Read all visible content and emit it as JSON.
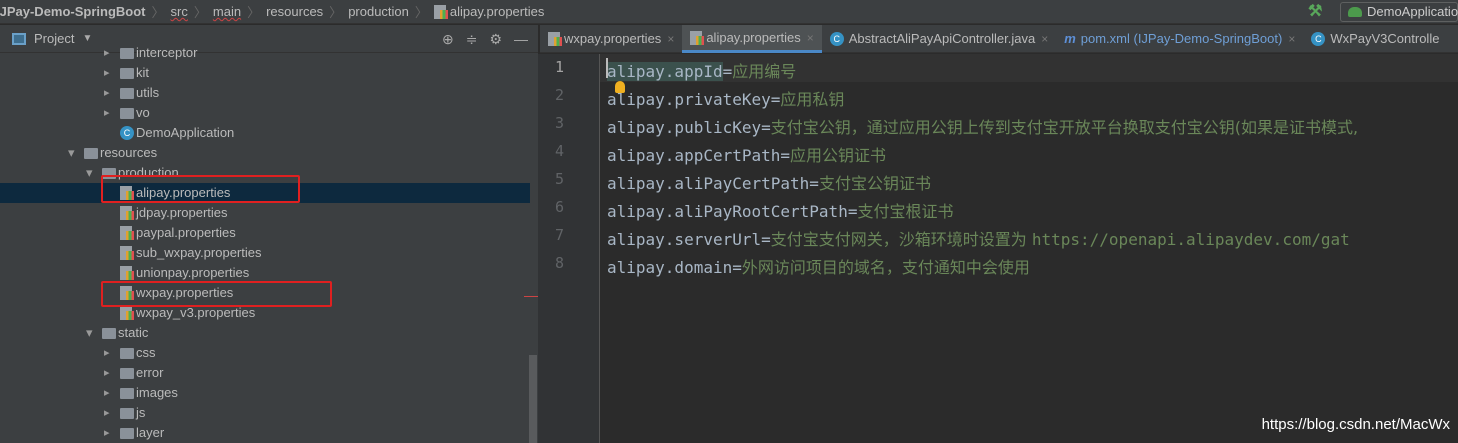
{
  "breadcrumb": [
    "IJPay-Demo-SpringBoot",
    "src",
    "main",
    "resources",
    "production",
    "alipay.properties"
  ],
  "run_config": "DemoApplication",
  "project_panel": {
    "title": "Project"
  },
  "tree": [
    {
      "label": "interceptor",
      "type": "folder",
      "level": 3
    },
    {
      "label": "kit",
      "type": "folder",
      "level": 3
    },
    {
      "label": "utils",
      "type": "folder",
      "level": 3
    },
    {
      "label": "vo",
      "type": "folder",
      "level": 3
    },
    {
      "label": "DemoApplication",
      "type": "class",
      "level": 3
    },
    {
      "label": "resources",
      "type": "folder",
      "level": 1,
      "expanded": true
    },
    {
      "label": "production",
      "type": "folder",
      "level": 2,
      "expanded": true
    },
    {
      "label": "alipay.properties",
      "type": "properties",
      "level": 3,
      "selected": true,
      "highlighted": true
    },
    {
      "label": "jdpay.properties",
      "type": "properties",
      "level": 3
    },
    {
      "label": "paypal.properties",
      "type": "properties",
      "level": 3
    },
    {
      "label": "sub_wxpay.properties",
      "type": "properties",
      "level": 3
    },
    {
      "label": "unionpay.properties",
      "type": "properties",
      "level": 3
    },
    {
      "label": "wxpay.properties",
      "type": "properties",
      "level": 3,
      "highlighted": true
    },
    {
      "label": "wxpay_v3.properties",
      "type": "properties",
      "level": 3
    },
    {
      "label": "static",
      "type": "folder",
      "level": 2,
      "expanded": true
    },
    {
      "label": "css",
      "type": "folder",
      "level": 3
    },
    {
      "label": "error",
      "type": "folder",
      "level": 3
    },
    {
      "label": "images",
      "type": "folder",
      "level": 3
    },
    {
      "label": "js",
      "type": "folder",
      "level": 3
    },
    {
      "label": "layer",
      "type": "folder",
      "level": 3
    }
  ],
  "tabs": [
    {
      "label": "wxpay.properties",
      "icon": "properties"
    },
    {
      "label": "alipay.properties",
      "icon": "properties",
      "active": true
    },
    {
      "label": "AbstractAliPayApiController.java",
      "icon": "class"
    },
    {
      "label": "pom.xml (IJPay-Demo-SpringBoot)",
      "icon": "maven"
    },
    {
      "label": "WxPayV3Controlle",
      "icon": "class"
    }
  ],
  "code": [
    {
      "key": "alipay.appId",
      "value": "应用编号"
    },
    {
      "key": "alipay.privateKey",
      "value": "应用私钥"
    },
    {
      "key": "alipay.publicKey",
      "value": "支付宝公钥，通过应用公钥上传到支付宝开放平台换取支付宝公钥(如果是证书模式,"
    },
    {
      "key": "alipay.appCertPath",
      "value": "应用公钥证书"
    },
    {
      "key": "alipay.aliPayCertPath",
      "value": "支付宝公钥证书"
    },
    {
      "key": "alipay.aliPayRootCertPath",
      "value": "支付宝根证书"
    },
    {
      "key": "alipay.serverUrl",
      "value": "支付宝支付网关，沙箱环境时设置为 ",
      "url": "https://openapi.alipaydev.com/gat"
    },
    {
      "key": "alipay.domain",
      "value": "外网访问项目的域名，支付通知中会使用"
    }
  ],
  "line_numbers": [
    "1",
    "2",
    "3",
    "4",
    "5",
    "6",
    "7",
    "8"
  ],
  "watermark": "https://blog.csdn.net/MacWx"
}
